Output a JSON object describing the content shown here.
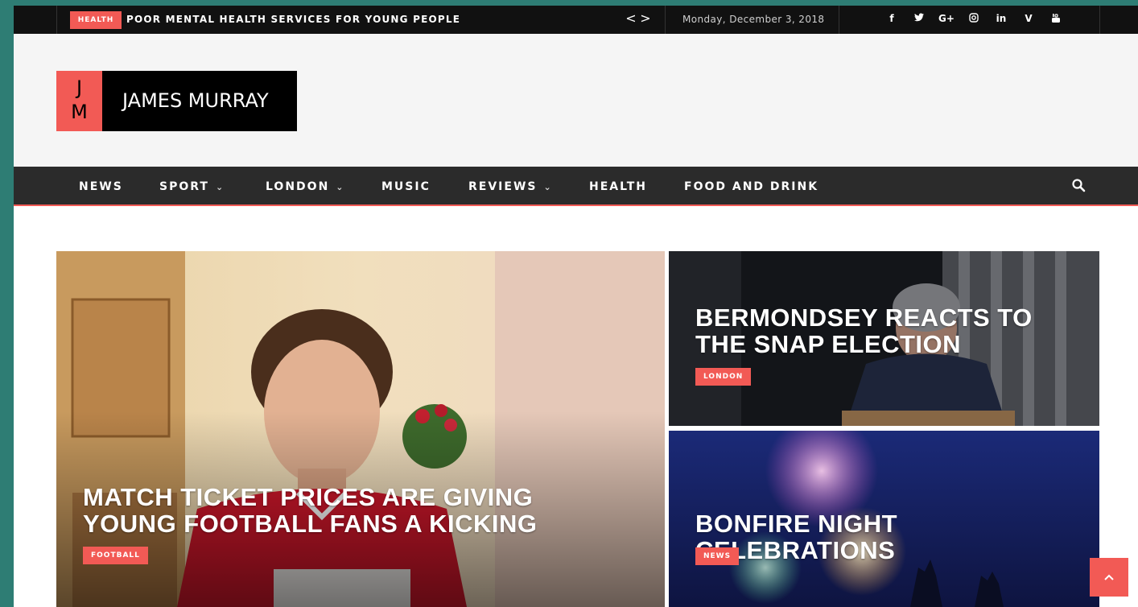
{
  "ticker": {
    "category": "HEALTH",
    "headline": "POOR MENTAL HEALTH SERVICES FOR YOUNG PEOPLE",
    "prev": "<",
    "next": ">"
  },
  "date": "Monday, December 3, 2018",
  "social": [
    {
      "icon": "facebook-icon",
      "glyph": "f"
    },
    {
      "icon": "twitter-icon",
      "glyph": "🐦"
    },
    {
      "icon": "google-plus-icon",
      "glyph": "G+"
    },
    {
      "icon": "instagram-icon",
      "glyph": "◎"
    },
    {
      "icon": "linkedin-icon",
      "glyph": "in"
    },
    {
      "icon": "vimeo-icon",
      "glyph": "V"
    },
    {
      "icon": "youtube-icon",
      "glyph": "▶"
    }
  ],
  "logo": {
    "mark_top": "J",
    "mark_bottom": "M",
    "name": "JAMES MURRAY"
  },
  "nav": {
    "items": [
      {
        "label": "NEWS",
        "dropdown": false
      },
      {
        "label": "SPORT",
        "dropdown": true
      },
      {
        "label": "LONDON",
        "dropdown": true
      },
      {
        "label": "MUSIC",
        "dropdown": false
      },
      {
        "label": "REVIEWS",
        "dropdown": true
      },
      {
        "label": "HEALTH",
        "dropdown": false
      },
      {
        "label": "FOOD AND DRINK",
        "dropdown": false
      }
    ],
    "search_icon": "search-icon"
  },
  "articles": {
    "main": {
      "title": "MATCH TICKET PRICES ARE GIVING YOUNG FOOTBALL FANS A KICKING",
      "category": "FOOTBALL"
    },
    "right_top": {
      "title": "BERMONDSEY REACTS TO THE SNAP ELECTION",
      "category": "LONDON"
    },
    "right_bottom": {
      "title": "BONFIRE NIGHT CELEBRATIONS",
      "category": "NEWS"
    }
  },
  "scroll_top_icon": "chevron-up-icon",
  "colors": {
    "accent": "#f25a55",
    "topbar": "#111111",
    "nav": "#2b2b2b",
    "header": "#f5f5f5",
    "desktop": "#2e7d74"
  }
}
